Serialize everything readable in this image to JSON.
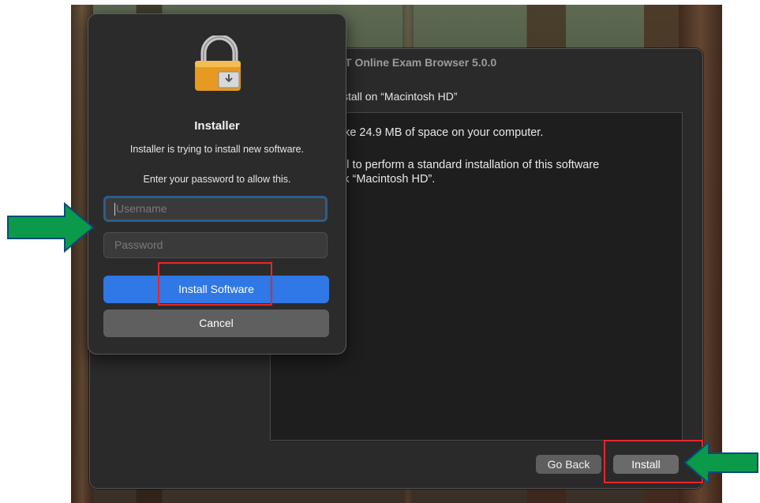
{
  "main_window": {
    "title": "T Online Exam Browser 5.0.0",
    "install_on": "stall on “Macintosh HD”",
    "content_lines": [
      "ake 24.9 MB of space on your computer.",
      "all to perform a standard installation of this software",
      "sk “Macintosh HD”."
    ],
    "go_back_label": "Go Back",
    "install_label": "Install"
  },
  "dialog": {
    "icon": "lock-installer-icon",
    "title": "Installer",
    "message": "Installer is trying to install new software.",
    "prompt": "Enter your password to allow this.",
    "username_placeholder": "Username",
    "password_placeholder": "Password",
    "install_software_label": "Install Software",
    "cancel_label": "Cancel"
  },
  "annotations": {
    "arrow_color": "#0a9a4a",
    "box_color": "#e8262b"
  }
}
